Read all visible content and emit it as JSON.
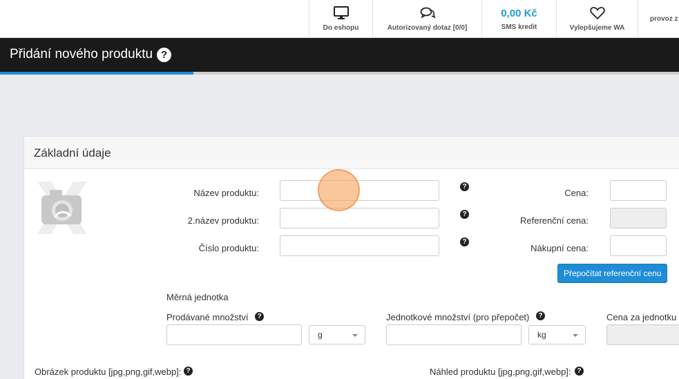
{
  "topnav": {
    "eshop_label": "Do eshopu",
    "query_label": "Autorizovaný dotaz [0/0]",
    "sms_value": "0,00 Kč",
    "sms_label": "SMS kredit",
    "improve_label": "Vylepšujeme WA",
    "provoz_label": "provoz z"
  },
  "page": {
    "title": "Přidání nového produktu",
    "help_glyph": "?"
  },
  "card": {
    "title": "Základní údaje"
  },
  "form": {
    "name_label": "Název produktu:",
    "name_value": "",
    "name2_label": "2.název produktu:",
    "name2_value": "",
    "number_label": "Číslo produktu:",
    "number_value": "",
    "price_label": "Cena:",
    "price_value": "",
    "ref_price_label": "Referenční cena:",
    "ref_price_value": "",
    "buy_price_label": "Nákupní cena:",
    "buy_price_value": "",
    "recalc_button": "Přepočítat referenční cenu",
    "unit_section": "Měrná jednotka",
    "sold_qty_label": "Prodávané množství",
    "sold_qty_value": "",
    "sold_unit": "g",
    "unit_qty_label": "Jednotkové množství (pro přepočet)",
    "unit_qty_value": "",
    "unit_qty_unit": "kg",
    "unit_price_label": "Cena za jednotku",
    "unit_price_value": "",
    "image_label": "Obrázek produktu [jpg,png,gif,webp]:",
    "preview_label": "Náhled produktu [jpg,png,gif,webp]:",
    "help_glyph": "?"
  },
  "icons": {
    "eshop": "monitor-icon",
    "query": "chat-icon",
    "improve": "heart-icon",
    "noimage": "camera-placeholder-icon"
  }
}
